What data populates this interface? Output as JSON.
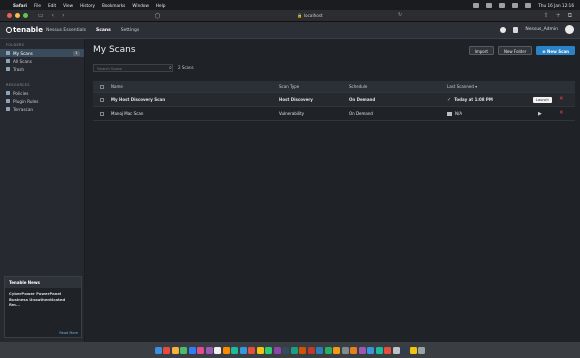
{
  "menubar": {
    "apple": "",
    "items": [
      "Safari",
      "File",
      "Edit",
      "View",
      "History",
      "Bookmarks",
      "Window",
      "Help"
    ],
    "datetime": "Thu 16 Jan 12:16"
  },
  "toolbar": {
    "url": "localhost"
  },
  "header": {
    "logo": "tenable",
    "product": "Nessus Essentials",
    "tabs": [
      "Scans",
      "Settings"
    ],
    "user": "Nessus_Admin"
  },
  "sidebar": {
    "folders_label": "FOLDERS",
    "folders": [
      {
        "label": "My Scans",
        "count": "1"
      },
      {
        "label": "All Scans"
      },
      {
        "label": "Trash"
      }
    ],
    "resources_label": "RESOURCES",
    "resources": [
      {
        "label": "Policies"
      },
      {
        "label": "Plugin Rules"
      },
      {
        "label": "Terrascan"
      }
    ],
    "news": {
      "title": "Tenable News",
      "body": "CyberPower PowerPanel Business Unauthenticated Rm...",
      "more": "Read More"
    }
  },
  "main": {
    "title": "My Scans",
    "buttons": {
      "import": "Import",
      "new_folder": "New Folder",
      "new_scan": "New Scan"
    },
    "search_placeholder": "Search Scans",
    "scan_count": "2 Scans",
    "columns": [
      "Name",
      "Scan Type",
      "Schedule",
      "Last Scanned ▾"
    ],
    "rows": [
      {
        "name": "My Host Discovery Scan",
        "type": "Host Discovery",
        "schedule": "On Demand",
        "last": "Today at 1:08 PM",
        "tooltip": "Launch"
      },
      {
        "name": "Manoj Mac Scan",
        "type": "Vulnerability",
        "schedule": "On Demand",
        "last": "N/A"
      }
    ]
  },
  "colors": {
    "accent": "#2a82c9",
    "danger": "#e24b4b",
    "sidebar_active": "#3a4b5c"
  }
}
